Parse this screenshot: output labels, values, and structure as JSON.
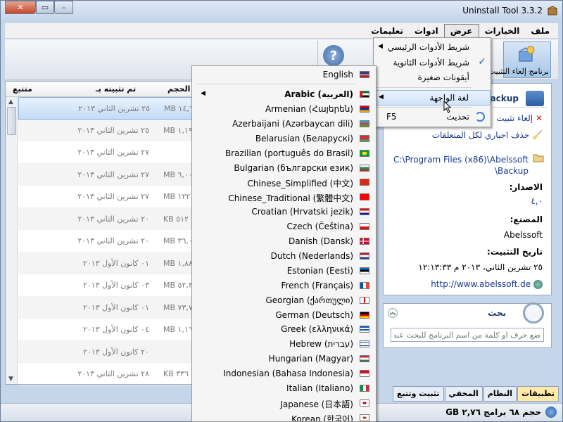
{
  "window": {
    "title": "Uninstall Tool 3.3.2"
  },
  "menubar": [
    "ملف",
    "الخيارات",
    "عرض",
    "ادوات",
    "تعليمات"
  ],
  "toolbar": {
    "uninstall_label": "برنامج إلغاء التثبيت",
    "help_label": "?"
  },
  "list": {
    "headers": {
      "size": "الحجم",
      "installed": "تم تثبيته بـ",
      "tracked": "متتبع"
    },
    "rows": [
      {
        "size": "MB ١٤,٦",
        "date": "٢٥ تشرين الثاني ٢٠١٣"
      },
      {
        "size": "MB ١,١٩",
        "date": "٢٥ تشرين الثاني ٢٠١٣"
      },
      {
        "size": "",
        "date": "٢٧ تشرين الثاني ٢٠١٣"
      },
      {
        "size": "MB ٦,٠٠",
        "date": "٢٧ تشرين الثاني ٢٠١٣"
      },
      {
        "size": "MB ١٢٢",
        "date": "٢٧ تشرين الثاني ٢٠١٣"
      },
      {
        "size": "KB ٥١٢",
        "date": "٢٠ تشرين الثاني ٢٠١٣"
      },
      {
        "size": "MB ٣٦,٠",
        "date": "٢٠ تشرين الثاني ٢٠١٣"
      },
      {
        "size": "MB ١,٨٨",
        "date": "٠١ كانون الأول ٢٠١٣"
      },
      {
        "size": "MB ٥٢,٣",
        "date": "٠٣ كانون الأول ٢٠١٣"
      },
      {
        "size": "MB ٧٣,٧",
        "date": "٠١ كانون الأول ٢٠١٣"
      },
      {
        "size": "MB ١,١٦",
        "date": "٠٤ كانون الأول ٢٠١٣"
      },
      {
        "size": "",
        "date": "٢٠ كانون الأول ٢٠١٣"
      },
      {
        "size": "KB ٣٣٦",
        "date": "٢٨ تشرين الثاني ٢٠١٣"
      }
    ]
  },
  "viewmenu": {
    "items": [
      {
        "label": "شريط الأدوات الرئيسي",
        "has_submenu": true
      },
      {
        "label": "شريط الأدوات الثانوية",
        "checked": true
      },
      {
        "label": "أيقونات صغيرة"
      },
      {
        "label": "لغة الواجهة",
        "has_submenu": true
      },
      {
        "label": "تحديث",
        "shortcut": "F5"
      }
    ]
  },
  "languages": [
    {
      "name": "English",
      "flag": "us"
    },
    {
      "name": "Arabic (العربية)",
      "flag": "ae",
      "bold": true
    },
    {
      "name": "Armenian (Հայերեն)",
      "flag": "am"
    },
    {
      "name": "Azerbaijani (Azərbaycan dili)",
      "flag": "az"
    },
    {
      "name": "Belarusian (Беларускі)",
      "flag": "by"
    },
    {
      "name": "Brazilian (português do Brasil)",
      "flag": "br"
    },
    {
      "name": "Bulgarian (български език)",
      "flag": "bg"
    },
    {
      "name": "Chinese_Simplified (中文)",
      "flag": "cn"
    },
    {
      "name": "Chinese_Traditional (繁體中文)",
      "flag": "tw"
    },
    {
      "name": "Croatian (Hrvatski jezik)",
      "flag": "hr"
    },
    {
      "name": "Czech (Čeština)",
      "flag": "cz"
    },
    {
      "name": "Danish (Dansk)",
      "flag": "dk"
    },
    {
      "name": "Dutch (Nederlands)",
      "flag": "nl"
    },
    {
      "name": "Estonian (Eesti)",
      "flag": "ee"
    },
    {
      "name": "French (Français)",
      "flag": "fr"
    },
    {
      "name": "Georgian (ქართული)",
      "flag": "ge"
    },
    {
      "name": "German (Deutsch)",
      "flag": "de"
    },
    {
      "name": "Greek (ελληνικά)",
      "flag": "gr"
    },
    {
      "name": "Hebrew (עברית)",
      "flag": "il"
    },
    {
      "name": "Hungarian (Magyar)",
      "flag": "hu"
    },
    {
      "name": "Indonesian (Bahasa Indonesia)",
      "flag": "id"
    },
    {
      "name": "Italian (Italiano)",
      "flag": "it"
    },
    {
      "name": "Japanese (日本語)",
      "flag": "jp"
    },
    {
      "name": "Korean (한국어)",
      "flag": "kr"
    }
  ],
  "flags": {
    "us": "linear-gradient(#3c3b6e 0 50%, #fff 50% 60%, #b22234 60%)",
    "ae": "linear-gradient(90deg,#ff0000 0 25%, transparent 25%), linear-gradient(#00732f 0 33%, #fff 33% 66%, #000 66%)",
    "am": "linear-gradient(#d90012 0 33%, #0033a0 33% 66%, #f2a800 66%)",
    "az": "linear-gradient(#00b5e2 0 33%, #ef3340 33% 66%, #509e2f 66%)",
    "by": "linear-gradient(#c8313e 0 66%, #4aa657 66%)",
    "br": "radial-gradient(#ffdf00 0 40%, #009c3b 41%)",
    "bg": "linear-gradient(#fff 0 33%, #00966e 33% 66%, #d62612 66%)",
    "cn": "linear-gradient(#de2910, #de2910)",
    "tw": "linear-gradient(#fe0000, #fe0000)",
    "hr": "linear-gradient(#ff0000 0 33%, #fff 33% 66%, #171796 66%)",
    "cz": "linear-gradient(#fff 0 50%, #d7141a 50%)",
    "dk": "linear-gradient(90deg, transparent 0 30%, #fff 30% 42%, transparent 42%), linear-gradient(#c60c30 0 42%, #fff 42% 58%, #c60c30 58%)",
    "nl": "linear-gradient(#ae1c28 0 33%, #fff 33% 66%, #21468b 66%)",
    "ee": "linear-gradient(#0072ce 0 33%, #000 33% 66%, #fff 66%)",
    "fr": "linear-gradient(90deg,#0055a4 0 33%, #fff 33% 66%, #ef4135 66%)",
    "ge": "linear-gradient(90deg, #fff 0 42%, #f00 42% 58%, #fff 58%)",
    "de": "linear-gradient(#000 0 33%, #dd0000 33% 66%, #ffce00 66%)",
    "gr": "repeating-linear-gradient(#0d5eaf 0 2px, #fff 2px 4px)",
    "il": "linear-gradient(#fff 0 15%, #0038b8 15% 25%, #fff 25% 75%, #0038b8 75% 85%, #fff 85%)",
    "hu": "linear-gradient(#ce2939 0 33%, #fff 33% 66%, #477050 66%)",
    "id": "linear-gradient(#ce1126 0 50%, #fff 50%)",
    "it": "linear-gradient(90deg,#009246 0 33%, #fff 33% 66%, #ce2b37 66%)",
    "jp": "radial-gradient(#bc002d 0 30%, #fff 31%)",
    "kr": "radial-gradient(#cd2e3a 0 30%, #fff 31%)"
  },
  "details": {
    "app_name": "Backup",
    "uninstall_link": "إلغاء تثبيت",
    "force_remove_link": "حذف اجباري لكل المتعلقات",
    "path_line1": "C:\\Program Files (x86)\\Abelssoft",
    "path_line2": "\\Backup",
    "version_label": "الاصدار:",
    "version_value": "٤,٠",
    "vendor_label": "المصنع:",
    "vendor_value": "Abelssoft",
    "install_date_label": "تاريخ التثبيت:",
    "install_date_value": "٢٥ تشرين الثاني، ٢٠١٣ م ١٢:١٣:٣٣",
    "website": "http://www.abelssoft.de"
  },
  "search": {
    "title": "بحث",
    "placeholder": "ضع حرف او كلمة من اسم البرنامج للبحث عنه"
  },
  "tabs": [
    "تطبيقات",
    "النظام",
    "المخفي",
    "تثبيت وتتبع"
  ],
  "status": {
    "text": "حجم ٦٨ برامج ٢,٧٦ GB"
  }
}
